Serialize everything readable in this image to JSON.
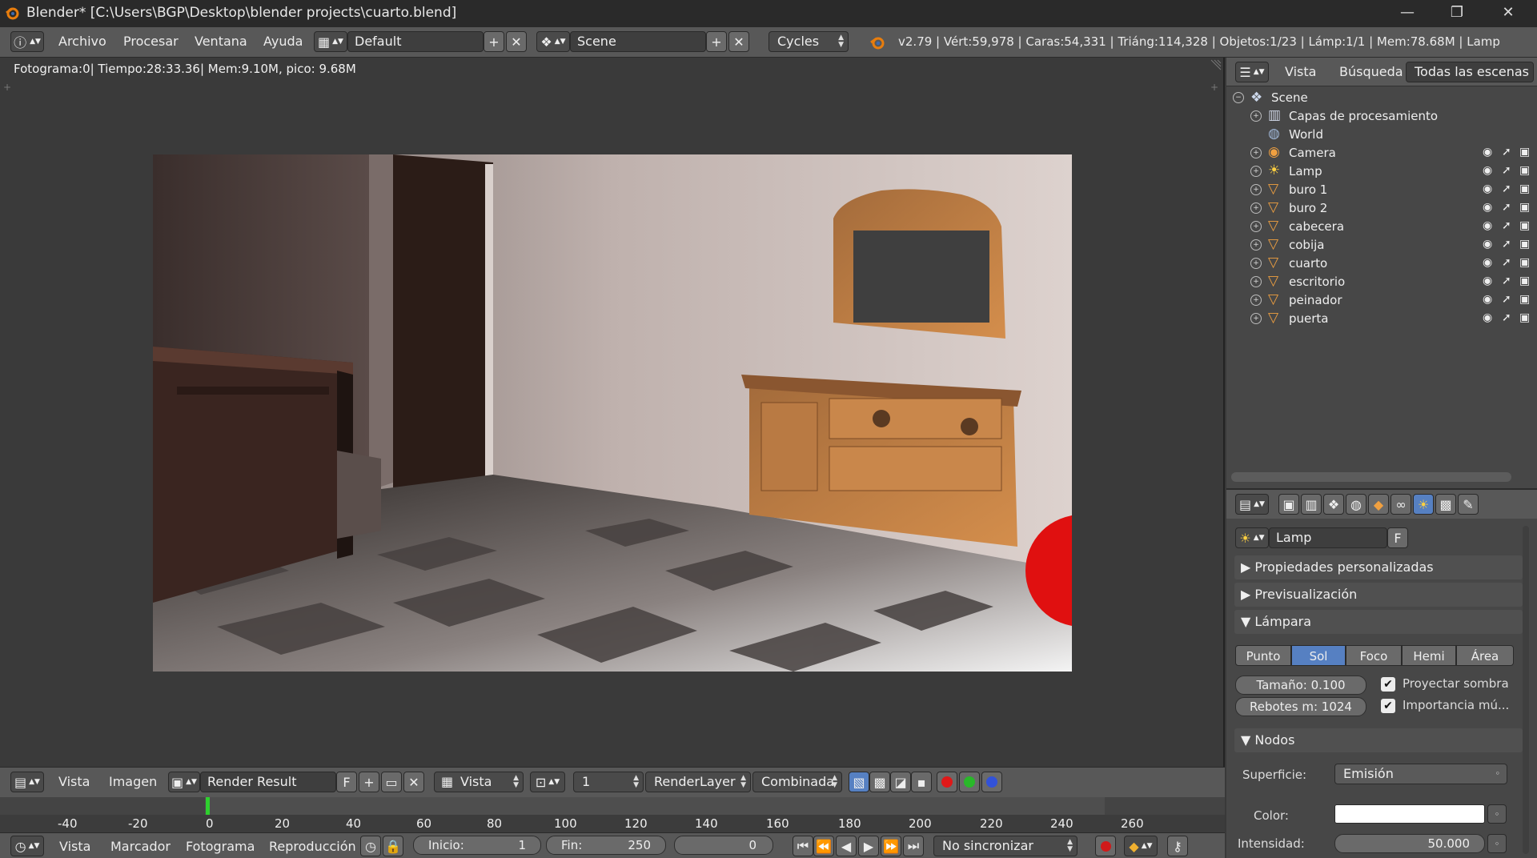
{
  "window": {
    "title": "Blender* [C:\\Users\\BGP\\Desktop\\blender projects\\cuarto.blend]",
    "min": "—",
    "max": "❐",
    "close": "✕"
  },
  "infobar": {
    "menus": [
      "Archivo",
      "Procesar",
      "Ventana",
      "Ayuda"
    ],
    "screen_layout": "Default",
    "scene": "Scene",
    "engine": "Cycles",
    "stats": "v2.79 | Vért:59,978 | Caras:54,331 | Triáng:114,328 | Objetos:1/23 | Lámp:1/1 | Mem:78.68M | Lamp"
  },
  "image_editor": {
    "frame_info": "Fotograma:0| Tiempo:28:33.36| Mem:9.10M, pico: 9.68M",
    "header": {
      "menus": [
        "Vista",
        "Imagen"
      ],
      "image_name": "Render Result",
      "fake_user": "F",
      "view_mode": "Vista",
      "slot": "1",
      "layer": "RenderLayer",
      "pass": "Combinada"
    }
  },
  "timeline": {
    "ticks": [
      "-40",
      "-20",
      "0",
      "20",
      "40",
      "60",
      "80",
      "100",
      "120",
      "140",
      "160",
      "180",
      "200",
      "220",
      "240",
      "260"
    ],
    "current_frame_fraction": 0.184,
    "header": {
      "menus": [
        "Vista",
        "Marcador",
        "Fotograma",
        "Reproducción"
      ],
      "start_label": "Inicio:",
      "start_value": "1",
      "end_label": "Fin:",
      "end_value": "250",
      "current": "0",
      "sync": "No sincronizar"
    }
  },
  "outliner": {
    "tabs": [
      "Vista",
      "Búsqueda",
      "Todas las escenas"
    ],
    "scene": "Scene",
    "items": [
      {
        "label": "Capas de procesamiento",
        "icon": "render-layers-icon"
      },
      {
        "label": "World",
        "icon": "world-icon"
      },
      {
        "label": "Camera",
        "icon": "camera-icon"
      },
      {
        "label": "Lamp",
        "icon": "lamp-icon"
      },
      {
        "label": "buro 1",
        "icon": "mesh-icon"
      },
      {
        "label": "buro 2",
        "icon": "mesh-icon"
      },
      {
        "label": "cabecera",
        "icon": "mesh-icon"
      },
      {
        "label": "cobija",
        "icon": "mesh-icon"
      },
      {
        "label": "cuarto",
        "icon": "mesh-icon"
      },
      {
        "label": "escritorio",
        "icon": "mesh-icon"
      },
      {
        "label": "peinador",
        "icon": "mesh-icon"
      },
      {
        "label": "puerta",
        "icon": "mesh-icon"
      }
    ]
  },
  "properties": {
    "datablock": "Lamp",
    "fake_user": "F",
    "panels": {
      "custom": "Propiedades personalizadas",
      "preview": "Previsualización",
      "lamp": "Lámpara",
      "nodes": "Nodos"
    },
    "lamp_types": [
      "Punto",
      "Sol",
      "Foco",
      "Hemi",
      "Área"
    ],
    "active_lamp_type": "Sol",
    "size": "Tamaño:  0.100",
    "bounces": "Rebotes m: 1024",
    "cast_shadow": "Proyectar sombra",
    "mis": "Importancia mú...",
    "surface_label": "Superficie:",
    "surface_value": "Emisión",
    "color_label": "Color:",
    "intensity_label": "Intensidad:",
    "intensity_value": "50.000"
  },
  "colors": {
    "accent": "#5680c2",
    "header": "#585858",
    "panel": "#474747",
    "editor_bg": "#3a3a3a"
  }
}
